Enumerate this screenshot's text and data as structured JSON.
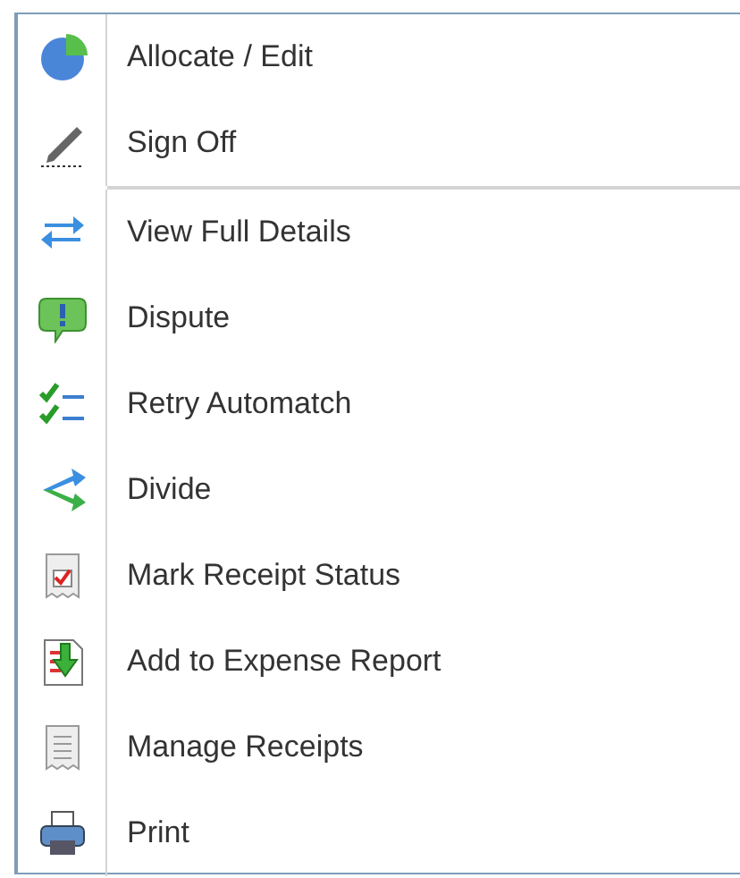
{
  "menu": {
    "groups": [
      {
        "items": [
          {
            "kind": "pie",
            "label": "Allocate / Edit"
          },
          {
            "kind": "pen",
            "label": "Sign Off"
          }
        ]
      },
      {
        "items": [
          {
            "kind": "arrows",
            "label": "View Full Details"
          },
          {
            "kind": "bubble",
            "label": "Dispute"
          },
          {
            "kind": "checklist",
            "label": "Retry Automatch"
          },
          {
            "kind": "split",
            "label": "Divide"
          },
          {
            "kind": "receipt-check",
            "label": "Mark Receipt Status"
          },
          {
            "kind": "report",
            "label": "Add to Expense Report"
          },
          {
            "kind": "receipt",
            "label": "Manage Receipts"
          },
          {
            "kind": "printer",
            "label": "Print"
          }
        ]
      }
    ]
  }
}
